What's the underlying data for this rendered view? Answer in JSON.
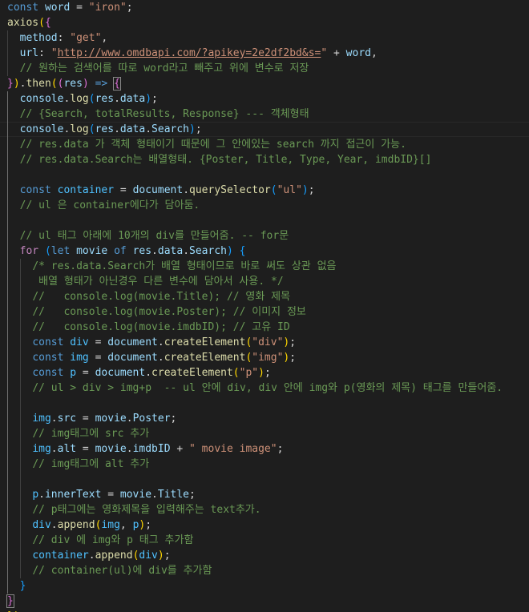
{
  "editor": {
    "language": "javascript",
    "theme": "Dark+",
    "colors": {
      "background": "#1e1e1e",
      "keyword": "#569cd6",
      "control": "#c586c0",
      "variable": "#9cdcfe",
      "function": "#dcdcaa",
      "string": "#ce9178",
      "comment": "#6a9955",
      "bracket_level1": "#ffd700",
      "bracket_level2": "#da70d6",
      "bracket_level3": "#179fff"
    },
    "lines": [
      [
        [
          "kw",
          "const"
        ],
        [
          "p",
          " "
        ],
        [
          "v",
          "word"
        ],
        [
          "p",
          " = "
        ],
        [
          "s",
          "\"iron\""
        ],
        [
          "p",
          ";"
        ]
      ],
      [
        [
          "fn",
          "axios"
        ],
        [
          "b1",
          "("
        ],
        [
          "b2",
          "{"
        ]
      ],
      [
        [
          "p",
          "  "
        ],
        [
          "v",
          "method"
        ],
        [
          "p",
          ": "
        ],
        [
          "s",
          "\"get\""
        ],
        [
          "p",
          ","
        ]
      ],
      [
        [
          "p",
          "  "
        ],
        [
          "v",
          "url"
        ],
        [
          "p",
          ": "
        ],
        [
          "s",
          "\""
        ],
        [
          "url",
          "http://www.omdbapi.com/?apikey=2e2df2bd&s="
        ],
        [
          "s",
          "\""
        ],
        [
          "p",
          " + "
        ],
        [
          "v",
          "word"
        ],
        [
          "p",
          ","
        ]
      ],
      [
        [
          "p",
          "  "
        ],
        [
          "c",
          "// 원하는 검색어를 따로 word라고 빼주고 위에 변수로 저장"
        ]
      ],
      [
        [
          "b2",
          "}"
        ],
        [
          "b1",
          ")"
        ],
        [
          "p",
          "."
        ],
        [
          "fn",
          "then"
        ],
        [
          "b1",
          "("
        ],
        [
          "b2",
          "("
        ],
        [
          "v",
          "res"
        ],
        [
          "b2",
          ")"
        ],
        [
          "p",
          " "
        ],
        [
          "kw",
          "=>"
        ],
        [
          "p",
          " "
        ],
        [
          "b2m",
          "{"
        ]
      ],
      [
        [
          "p",
          "  "
        ],
        [
          "v",
          "console"
        ],
        [
          "p",
          "."
        ],
        [
          "fn",
          "log"
        ],
        [
          "b3",
          "("
        ],
        [
          "v",
          "res"
        ],
        [
          "p",
          "."
        ],
        [
          "v",
          "data"
        ],
        [
          "b3",
          ")"
        ],
        [
          "p",
          ";"
        ]
      ],
      [
        [
          "p",
          "  "
        ],
        [
          "c",
          "// {Search, totalResults, Response} --- 객체형태"
        ]
      ],
      [
        [
          "p",
          "  "
        ],
        [
          "v",
          "console"
        ],
        [
          "p",
          "."
        ],
        [
          "fn",
          "log"
        ],
        [
          "b3",
          "("
        ],
        [
          "v",
          "res"
        ],
        [
          "p",
          "."
        ],
        [
          "v",
          "data"
        ],
        [
          "p",
          "."
        ],
        [
          "v",
          "Search"
        ],
        [
          "b3",
          ")"
        ],
        [
          "p",
          ";"
        ]
      ],
      [
        [
          "p",
          "  "
        ],
        [
          "c",
          "// res.data 가 객체 형태이기 때문에 그 안에있는 search 까지 접근이 가능."
        ]
      ],
      [
        [
          "p",
          "  "
        ],
        [
          "c",
          "// res.data.Search는 배열형태. {Poster, Title, Type, Year, imdbID}[]"
        ]
      ],
      [],
      [
        [
          "p",
          "  "
        ],
        [
          "kw",
          "const"
        ],
        [
          "p",
          " "
        ],
        [
          "con",
          "container"
        ],
        [
          "p",
          " = "
        ],
        [
          "v",
          "document"
        ],
        [
          "p",
          "."
        ],
        [
          "fn",
          "querySelector"
        ],
        [
          "b3",
          "("
        ],
        [
          "s",
          "\"ul\""
        ],
        [
          "b3",
          ")"
        ],
        [
          "p",
          ";"
        ]
      ],
      [
        [
          "p",
          "  "
        ],
        [
          "c",
          "// ul 은 container에다가 담아둠."
        ]
      ],
      [],
      [
        [
          "p",
          "  "
        ],
        [
          "c",
          "// ul 태그 아래에 10개의 div를 만들어줌. -- for문"
        ]
      ],
      [
        [
          "p",
          "  "
        ],
        [
          "ctl",
          "for"
        ],
        [
          "p",
          " "
        ],
        [
          "b3",
          "("
        ],
        [
          "kw",
          "let"
        ],
        [
          "p",
          " "
        ],
        [
          "v",
          "movie"
        ],
        [
          "p",
          " "
        ],
        [
          "kw",
          "of"
        ],
        [
          "p",
          " "
        ],
        [
          "v",
          "res"
        ],
        [
          "p",
          "."
        ],
        [
          "v",
          "data"
        ],
        [
          "p",
          "."
        ],
        [
          "v",
          "Search"
        ],
        [
          "b3",
          ")"
        ],
        [
          "p",
          " "
        ],
        [
          "b3",
          "{"
        ]
      ],
      [
        [
          "p",
          "    "
        ],
        [
          "c",
          "/* res.data.Search가 배열 형태이므로 바로 써도 상관 없음"
        ]
      ],
      [
        [
          "p",
          "    "
        ],
        [
          "c",
          " 배열 형태가 아닌경우 다른 변수에 담아서 사용. */"
        ]
      ],
      [
        [
          "p",
          "    "
        ],
        [
          "c",
          "//   console.log(movie.Title); // 영화 제목"
        ]
      ],
      [
        [
          "p",
          "    "
        ],
        [
          "c",
          "//   console.log(movie.Poster); // 이미지 정보"
        ]
      ],
      [
        [
          "p",
          "    "
        ],
        [
          "c",
          "//   console.log(movie.imdbID); // 고유 ID"
        ]
      ],
      [
        [
          "p",
          "    "
        ],
        [
          "kw",
          "const"
        ],
        [
          "p",
          " "
        ],
        [
          "con",
          "div"
        ],
        [
          "p",
          " = "
        ],
        [
          "v",
          "document"
        ],
        [
          "p",
          "."
        ],
        [
          "fn",
          "createElement"
        ],
        [
          "b1",
          "("
        ],
        [
          "s",
          "\"div\""
        ],
        [
          "b1",
          ")"
        ],
        [
          "p",
          ";"
        ]
      ],
      [
        [
          "p",
          "    "
        ],
        [
          "kw",
          "const"
        ],
        [
          "p",
          " "
        ],
        [
          "con",
          "img"
        ],
        [
          "p",
          " = "
        ],
        [
          "v",
          "document"
        ],
        [
          "p",
          "."
        ],
        [
          "fn",
          "createElement"
        ],
        [
          "b1",
          "("
        ],
        [
          "s",
          "\"img\""
        ],
        [
          "b1",
          ")"
        ],
        [
          "p",
          ";"
        ]
      ],
      [
        [
          "p",
          "    "
        ],
        [
          "kw",
          "const"
        ],
        [
          "p",
          " "
        ],
        [
          "con",
          "p"
        ],
        [
          "p",
          " = "
        ],
        [
          "v",
          "document"
        ],
        [
          "p",
          "."
        ],
        [
          "fn",
          "createElement"
        ],
        [
          "b1",
          "("
        ],
        [
          "s",
          "\"p\""
        ],
        [
          "b1",
          ")"
        ],
        [
          "p",
          ";"
        ]
      ],
      [
        [
          "p",
          "    "
        ],
        [
          "c",
          "// ul > div > img+p  -- ul 안에 div, div 안에 img와 p(영화의 제목) 태그를 만들어줌."
        ]
      ],
      [],
      [
        [
          "p",
          "    "
        ],
        [
          "con",
          "img"
        ],
        [
          "p",
          "."
        ],
        [
          "v",
          "src"
        ],
        [
          "p",
          " = "
        ],
        [
          "v",
          "movie"
        ],
        [
          "p",
          "."
        ],
        [
          "v",
          "Poster"
        ],
        [
          "p",
          ";"
        ]
      ],
      [
        [
          "p",
          "    "
        ],
        [
          "c",
          "// img태그에 src 추가"
        ]
      ],
      [
        [
          "p",
          "    "
        ],
        [
          "con",
          "img"
        ],
        [
          "p",
          "."
        ],
        [
          "v",
          "alt"
        ],
        [
          "p",
          " = "
        ],
        [
          "v",
          "movie"
        ],
        [
          "p",
          "."
        ],
        [
          "v",
          "imdbID"
        ],
        [
          "p",
          " + "
        ],
        [
          "s",
          "\" movie image\""
        ],
        [
          "p",
          ";"
        ]
      ],
      [
        [
          "p",
          "    "
        ],
        [
          "c",
          "// img태그에 alt 추가"
        ]
      ],
      [],
      [
        [
          "p",
          "    "
        ],
        [
          "con",
          "p"
        ],
        [
          "p",
          "."
        ],
        [
          "v",
          "innerText"
        ],
        [
          "p",
          " = "
        ],
        [
          "v",
          "movie"
        ],
        [
          "p",
          "."
        ],
        [
          "v",
          "Title"
        ],
        [
          "p",
          ";"
        ]
      ],
      [
        [
          "p",
          "    "
        ],
        [
          "c",
          "// p태그에는 영화제목을 입력해주는 text추가."
        ]
      ],
      [
        [
          "p",
          "    "
        ],
        [
          "con",
          "div"
        ],
        [
          "p",
          "."
        ],
        [
          "fn",
          "append"
        ],
        [
          "b1",
          "("
        ],
        [
          "con",
          "img"
        ],
        [
          "p",
          ", "
        ],
        [
          "con",
          "p"
        ],
        [
          "b1",
          ")"
        ],
        [
          "p",
          ";"
        ]
      ],
      [
        [
          "p",
          "    "
        ],
        [
          "c",
          "// div 에 img와 p 태그 추가함"
        ]
      ],
      [
        [
          "p",
          "    "
        ],
        [
          "con",
          "container"
        ],
        [
          "p",
          "."
        ],
        [
          "fn",
          "append"
        ],
        [
          "b1",
          "("
        ],
        [
          "con",
          "div"
        ],
        [
          "b1",
          ")"
        ],
        [
          "p",
          ";"
        ]
      ],
      [
        [
          "p",
          "    "
        ],
        [
          "c",
          "// container(ul)에 div를 추가함"
        ]
      ],
      [
        [
          "p",
          "  "
        ],
        [
          "b3",
          "}"
        ]
      ],
      [
        [
          "b2m",
          "}"
        ]
      ],
      [
        [
          "b1",
          "}"
        ],
        [
          "b1",
          ")"
        ],
        [
          "p",
          ";"
        ]
      ]
    ]
  }
}
